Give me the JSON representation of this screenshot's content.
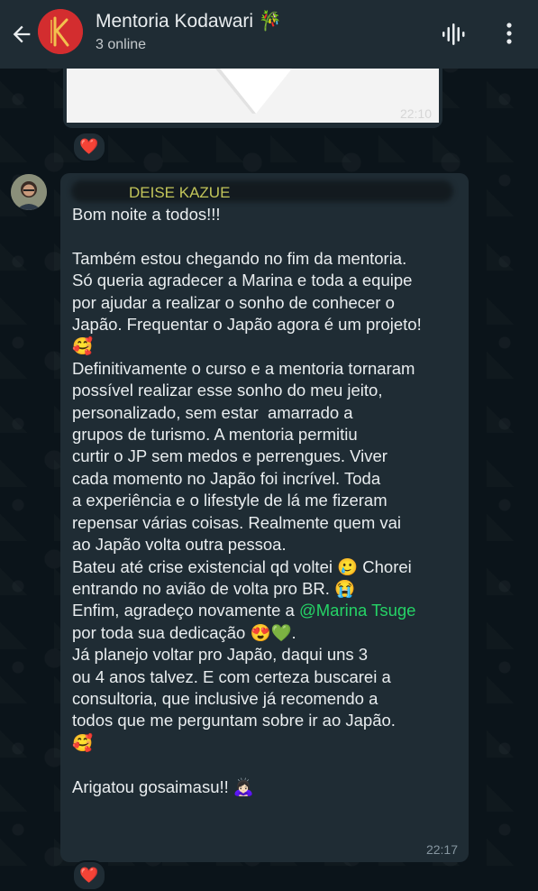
{
  "header": {
    "title": "Mentoria Kodawari 🎋",
    "status": "3 online"
  },
  "previous_message": {
    "time": "22:10",
    "reaction": "❤️"
  },
  "message": {
    "sender": "DEISE KAZUE",
    "lines": [
      "Bom noite a todos!!!",
      "",
      "Também estou chegando no fim da mentoria.",
      "Só queria agradecer a Marina e toda a equipe",
      "por ajudar a realizar o sonho de conhecer o",
      "Japão. Frequentar o Japão agora é um projeto!",
      "🥰",
      "Definitivamente o curso e a mentoria tornaram",
      "possível realizar esse sonho do meu jeito,",
      "personalizado, sem estar  amarrado a",
      "grupos de turismo. A mentoria permitiu",
      "curtir o JP sem medos e perrengues. Viver",
      "cada momento no Japão foi incrível. Toda",
      "a experiência e o lifestyle de lá me fizeram",
      "repensar várias coisas. Realmente quem vai",
      "ao Japão volta outra pessoa.",
      "Bateu até crise existencial qd voltei 🥲 Chorei",
      "entrando no avião de volta pro BR. 😭"
    ],
    "line_enfim": "Enfim, agradeço novamente a ",
    "mention": "@Marina Tsuge",
    "line_dedicacao": "por toda sua dedicação 😍💚.",
    "lines_after": [
      "Já planejo voltar pro Japão, daqui uns 3",
      "ou 4 anos talvez. E com certeza buscarei a",
      "consultoria, que inclusive já recomendo a",
      "todos que me perguntam sobre ir ao Japão.",
      "🥰",
      "",
      "Arigatou gosaimasu!! 🙇🏻‍♀️"
    ],
    "time": "22:17",
    "reaction": "❤️"
  },
  "colors": {
    "background": "#0b141a",
    "bubble": "#1f2c34",
    "sender_name": "#c2c55a",
    "mention": "#25d366"
  }
}
